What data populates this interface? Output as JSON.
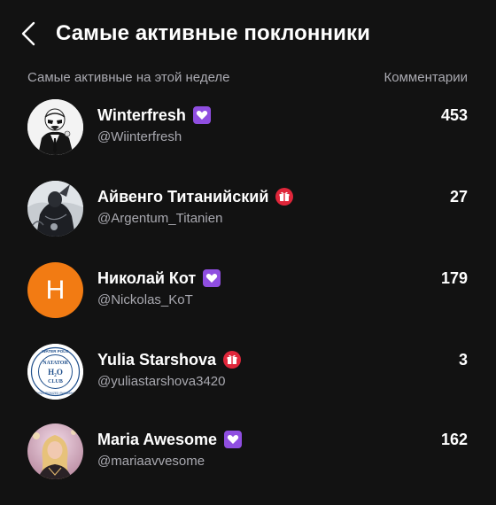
{
  "header": {
    "title": "Самые активные поклонники",
    "back_icon": "chevron-left-icon"
  },
  "columns": {
    "left": "Самые активные на этой неделе",
    "right": "Комментарии"
  },
  "colors": {
    "background": "#121212",
    "secondary_text": "#a9a9b0",
    "subscriber_badge": "#8f4ee0",
    "gift_badge": "#e0263a",
    "letter_avatar": "#f27b13"
  },
  "fans": [
    {
      "name": "Winterfresh",
      "handle": "@Wiinterfresh",
      "comments": "453",
      "badge": "subscriber-heart-icon",
      "avatar": "stormtrooper-avatar"
    },
    {
      "name": "Айвенго Титанийский",
      "handle": "@Argentum_Titanien",
      "comments": "27",
      "badge": "gift-icon",
      "avatar": "dark-figure-avatar"
    },
    {
      "name": "Николай Кот",
      "handle": "@Nickolas_KoT",
      "comments": "179",
      "badge": "subscriber-heart-icon",
      "avatar": "letter-avatar",
      "avatar_letter": "H"
    },
    {
      "name": "Yulia Starshova",
      "handle": "@yuliastarshova3420",
      "comments": "3",
      "badge": "gift-icon",
      "avatar": "club-logo-avatar",
      "avatar_text": {
        "top": "WATER POLO",
        "main": "NATATOR",
        "formula": "H₂O",
        "sub": "CLUB",
        "bottom": "SYNCHRONIZED SWIMMING"
      }
    },
    {
      "name": "Maria Awesome",
      "handle": "@mariaavvesome",
      "comments": "162",
      "badge": "subscriber-heart-icon",
      "avatar": "photo-avatar"
    }
  ]
}
